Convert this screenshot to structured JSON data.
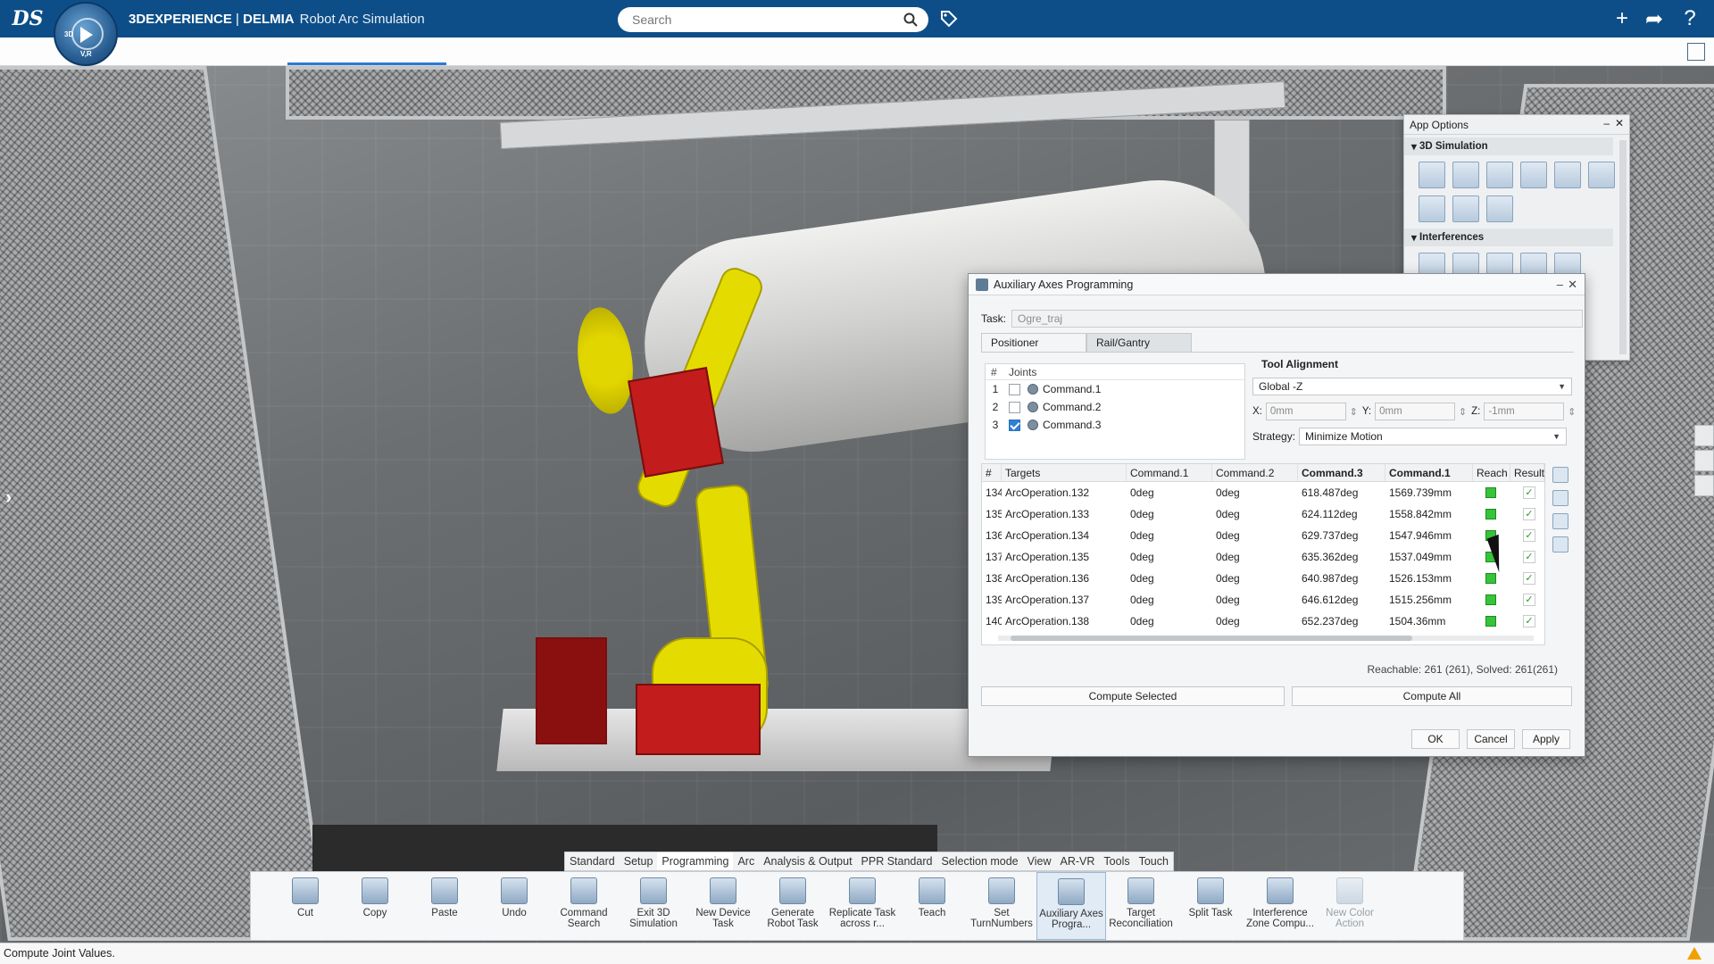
{
  "header": {
    "brand": "3DEXPERIENCE",
    "separator": " | ",
    "product": "DELMIA",
    "app_name": "Robot Arc Simulation",
    "search_placeholder": "Search",
    "compass_labels": [
      "3D",
      "V,R"
    ]
  },
  "app_options": {
    "title": "App Options",
    "sections": [
      "3D Simulation",
      "Interferences"
    ]
  },
  "dialog": {
    "title": "Auxiliary Axes Programming",
    "task_label": "Task:",
    "task_value": "Ogre_traj",
    "tabs": [
      "Positioner",
      "Rail/Gantry"
    ],
    "joints": {
      "header_num": "#",
      "header_label": "Joints",
      "rows": [
        {
          "num": "1",
          "name": "Command.1",
          "checked": false
        },
        {
          "num": "2",
          "name": "Command.2",
          "checked": false
        },
        {
          "num": "3",
          "name": "Command.3",
          "checked": true
        }
      ]
    },
    "tool_alignment": {
      "title": "Tool Alignment",
      "axis": "Global -Z",
      "x_label": "X:",
      "x_value": "0mm",
      "y_label": "Y:",
      "y_value": "0mm",
      "z_label": "Z:",
      "z_value": "-1mm",
      "strategy_label": "Strategy:",
      "strategy_value": "Minimize Motion"
    },
    "table": {
      "columns": [
        "#",
        "Targets",
        "Command.1",
        "Command.2",
        "Command.3",
        "Command.1",
        "Reach",
        "Result"
      ],
      "rows": [
        [
          "134",
          "ArcOperation.132",
          "0deg",
          "0deg",
          "618.487deg",
          "1569.739mm"
        ],
        [
          "135",
          "ArcOperation.133",
          "0deg",
          "0deg",
          "624.112deg",
          "1558.842mm"
        ],
        [
          "136",
          "ArcOperation.134",
          "0deg",
          "0deg",
          "629.737deg",
          "1547.946mm"
        ],
        [
          "137",
          "ArcOperation.135",
          "0deg",
          "0deg",
          "635.362deg",
          "1537.049mm"
        ],
        [
          "138",
          "ArcOperation.136",
          "0deg",
          "0deg",
          "640.987deg",
          "1526.153mm"
        ],
        [
          "139",
          "ArcOperation.137",
          "0deg",
          "0deg",
          "646.612deg",
          "1515.256mm"
        ],
        [
          "140",
          "ArcOperation.138",
          "0deg",
          "0deg",
          "652.237deg",
          "1504.36mm"
        ]
      ],
      "result_mark": "✓"
    },
    "reachable_summary": "Reachable: 261 (261), Solved: 261(261)",
    "compute_selected": "Compute Selected",
    "compute_all": "Compute All",
    "ok": "OK",
    "cancel": "Cancel",
    "apply": "Apply"
  },
  "action_bar": {
    "tabs": [
      "Standard",
      "Setup",
      "Programming",
      "Arc",
      "Analysis & Output",
      "PPR Standard",
      "Selection mode",
      "View",
      "AR-VR",
      "Tools",
      "Touch"
    ],
    "active_tab": "Programming",
    "tools": [
      {
        "label": "Cut",
        "icon": "scissors-icon"
      },
      {
        "label": "Copy",
        "icon": "copy-icon"
      },
      {
        "label": "Paste",
        "icon": "paste-icon"
      },
      {
        "label": "Undo",
        "icon": "undo-icon"
      },
      {
        "label": "Command Search",
        "icon": "command-search-icon"
      },
      {
        "label": "Exit 3D Simulation",
        "icon": "exit-simulation-icon"
      },
      {
        "label": "New Device Task",
        "icon": "device-task-icon"
      },
      {
        "label": "Generate Robot Task",
        "icon": "robot-task-icon"
      },
      {
        "label": "Replicate Task across r...",
        "icon": "replicate-icon"
      },
      {
        "label": "Teach",
        "icon": "teach-icon"
      },
      {
        "label": "Set TurnNumbers",
        "icon": "turn-numbers-icon"
      },
      {
        "label": "Auxiliary Axes Progra...",
        "icon": "auxiliary-axes-icon"
      },
      {
        "label": "Target Reconciliation",
        "icon": "target-reconciliation-icon"
      },
      {
        "label": "Split Task",
        "icon": "split-task-icon"
      },
      {
        "label": "Interference Zone Compu...",
        "icon": "interference-zone-icon"
      },
      {
        "label": "New Color Action",
        "icon": "color-action-icon"
      }
    ]
  },
  "status_bar": {
    "message": "Compute Joint Values."
  },
  "colors": {
    "topbar": "#0d4e88",
    "reach_ok": "#35c43a",
    "robot_yellow": "#e4dc00",
    "robot_red": "#c31c1c"
  }
}
